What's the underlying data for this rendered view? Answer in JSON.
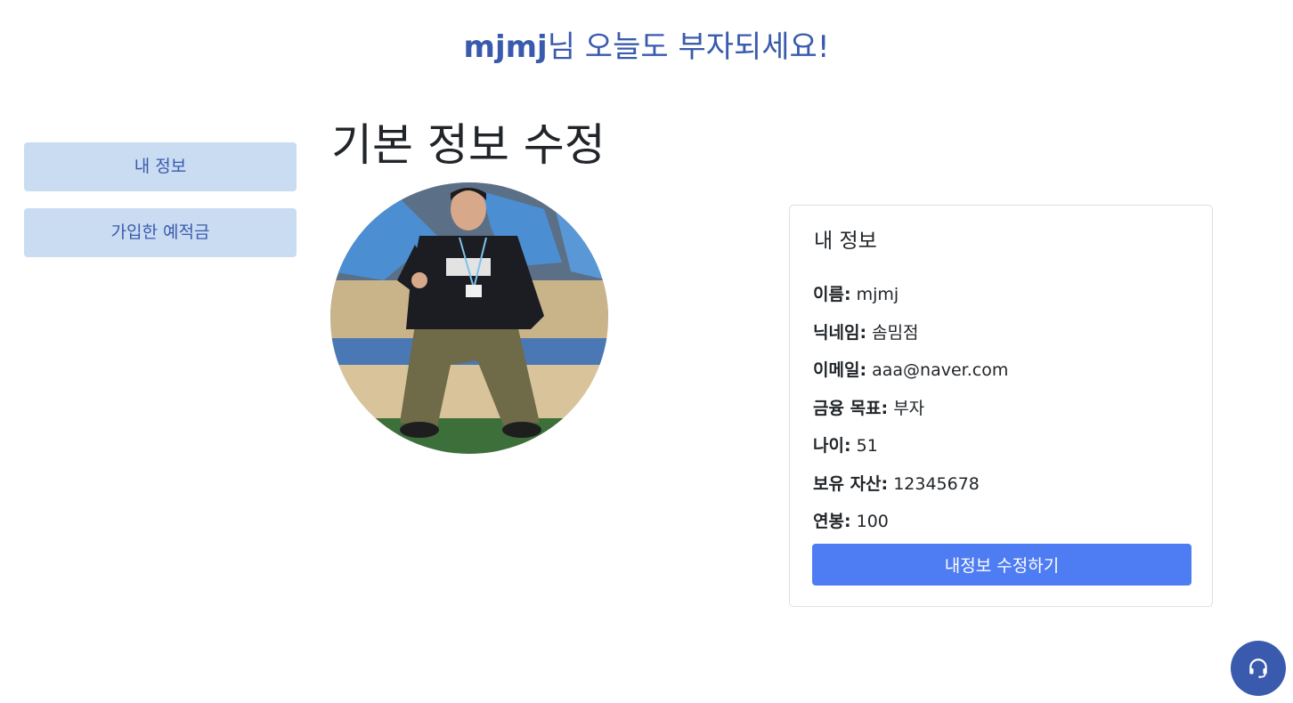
{
  "header": {
    "username": "mjmj",
    "greeting_suffix": "님 오늘도 부자되세요!"
  },
  "sidebar": {
    "items": [
      {
        "label": "내 정보"
      },
      {
        "label": "가입한 예적금"
      }
    ]
  },
  "main": {
    "title": "기본 정보 수정"
  },
  "profile_card": {
    "title": "내 정보",
    "rows": [
      {
        "label": "이름:",
        "value": "mjmj"
      },
      {
        "label": "닉네임:",
        "value": "솜밈점"
      },
      {
        "label": "이메일:",
        "value": "aaa@naver.com"
      },
      {
        "label": "금융 목표:",
        "value": "부자"
      },
      {
        "label": "나이:",
        "value": "51"
      },
      {
        "label": "보유 자산:",
        "value": "12345678"
      },
      {
        "label": "연봉:",
        "value": "100"
      }
    ],
    "edit_button_label": "내정보 수정하기"
  },
  "support": {
    "icon": "headset-icon"
  },
  "colors": {
    "brand": "#3a5bad",
    "sidebar_bg": "#cadcf2",
    "primary_button": "#4e7cf3"
  }
}
